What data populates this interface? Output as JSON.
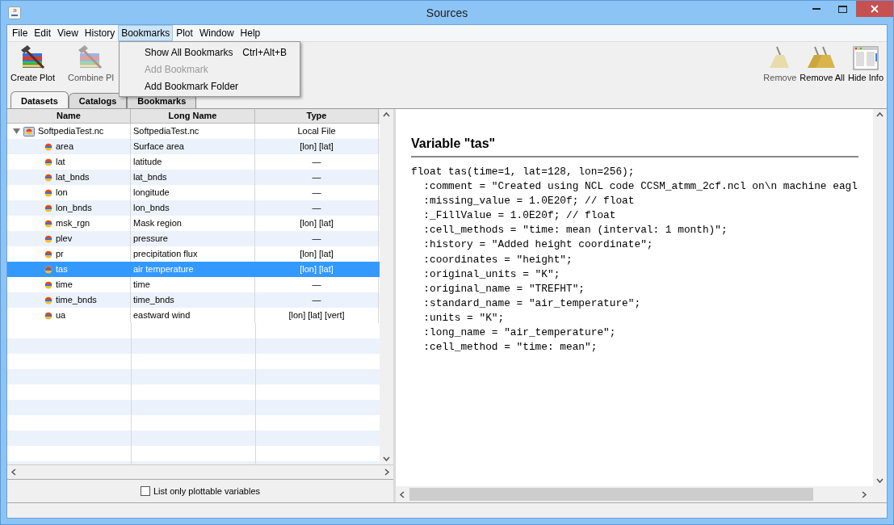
{
  "window": {
    "title": "Sources"
  },
  "menu": [
    {
      "label": "File",
      "selected": false
    },
    {
      "label": "Edit",
      "selected": false
    },
    {
      "label": "View",
      "selected": false
    },
    {
      "label": "History",
      "selected": false
    },
    {
      "label": "Bookmarks",
      "selected": true
    },
    {
      "label": "Plot",
      "selected": false
    },
    {
      "label": "Window",
      "selected": false
    },
    {
      "label": "Help",
      "selected": false
    }
  ],
  "open_menu": [
    {
      "label": "Show All Bookmarks",
      "shortcut": "Ctrl+Alt+B",
      "disabled": false
    },
    {
      "label": "Add Bookmark",
      "disabled": true
    },
    {
      "label": "Add Bookmark Folder",
      "disabled": false
    }
  ],
  "toolbar_left": [
    {
      "label": "Create Plot",
      "kind": "create",
      "disabled": false
    },
    {
      "label": "Combine Pl",
      "kind": "combine",
      "disabled": true
    }
  ],
  "toolbar_right": [
    {
      "label": "Remove",
      "kind": "broom",
      "disabled": true
    },
    {
      "label": "Remove All",
      "kind": "brooms",
      "disabled": false
    },
    {
      "label": "Hide Info",
      "kind": "info",
      "disabled": false
    }
  ],
  "tabs": [
    {
      "label": "Datasets",
      "selected": true
    },
    {
      "label": "Catalogs",
      "selected": false
    },
    {
      "label": "Bookmarks",
      "selected": false
    }
  ],
  "table": {
    "columns": [
      "Name",
      "Long Name",
      "Type"
    ],
    "rows": [
      {
        "name": "SoftpediaTest.nc",
        "long_name": "SoftpediaTest.nc",
        "type": "Local File",
        "expanded": true,
        "selected": false,
        "children": [
          {
            "name": "area",
            "long_name": "Surface area",
            "type": "[lon] [lat]",
            "selected": false
          },
          {
            "name": "lat",
            "long_name": "latitude",
            "type": "—",
            "selected": false
          },
          {
            "name": "lat_bnds",
            "long_name": "lat_bnds",
            "type": "—",
            "selected": false
          },
          {
            "name": "lon",
            "long_name": "longitude",
            "type": "—",
            "selected": false
          },
          {
            "name": "lon_bnds",
            "long_name": "lon_bnds",
            "type": "—",
            "selected": false
          },
          {
            "name": "msk_rgn",
            "long_name": "Mask region",
            "type": "[lon] [lat]",
            "selected": false
          },
          {
            "name": "plev",
            "long_name": "pressure",
            "type": "—",
            "selected": false
          },
          {
            "name": "pr",
            "long_name": "precipitation flux",
            "type": "[lon] [lat]",
            "selected": false
          },
          {
            "name": "tas",
            "long_name": "air temperature",
            "type": "[lon] [lat]",
            "selected": true
          },
          {
            "name": "time",
            "long_name": "time",
            "type": "—",
            "selected": false
          },
          {
            "name": "time_bnds",
            "long_name": "time_bnds",
            "type": "—",
            "selected": false
          },
          {
            "name": "ua",
            "long_name": "eastward wind",
            "type": "[lon] [lat] [vert]",
            "selected": false
          }
        ]
      }
    ]
  },
  "plottable_only": {
    "label": "List only plottable variables",
    "checked": false
  },
  "info": {
    "title": "Variable \"tas\"",
    "lines": [
      "float tas(time=1, lat=128, lon=256);",
      "  :comment = \"Created using NCL code CCSM_atmm_2cf.ncl on\\n machine eagl",
      "  :missing_value = 1.0E20f; // float",
      "  :_FillValue = 1.0E20f; // float",
      "  :cell_methods = \"time: mean (interval: 1 month)\";",
      "  :history = \"Added height coordinate\";",
      "  :coordinates = \"height\";",
      "  :original_units = \"K\";",
      "  :original_name = \"TREFHT\";",
      "  :standard_name = \"air_temperature\";",
      "  :units = \"K\";",
      "  :long_name = \"air_temperature\";",
      "  :cell_method = \"time: mean\";"
    ]
  }
}
